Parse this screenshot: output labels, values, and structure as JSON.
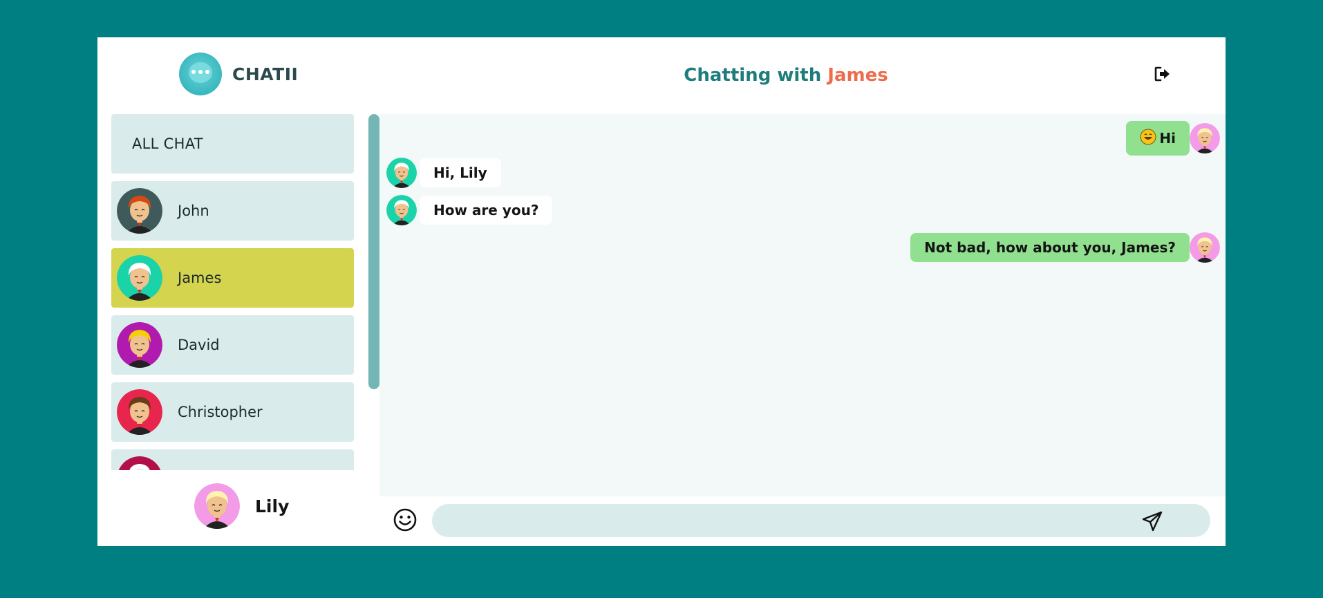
{
  "brand": {
    "name": "CHATII"
  },
  "header": {
    "prefix": "Chatting with",
    "contact": "James",
    "title_color": "#1f7c7c",
    "contact_color": "#ee6b4d",
    "logout_icon": "logout-icon"
  },
  "sidebar": {
    "all_chat": "ALL CHAT",
    "contacts": [
      {
        "name": "John",
        "avatar_bg": "#3f5a5a",
        "hair": "#d44a12",
        "active": false
      },
      {
        "name": "James",
        "avatar_bg": "#1bd3a8",
        "hair": "#ffffff",
        "active": true
      },
      {
        "name": "David",
        "avatar_bg": "#b01aae",
        "hair": "#f4d000",
        "active": false
      },
      {
        "name": "Christopher",
        "avatar_bg": "#e8254c",
        "hair": "#6b3b1a",
        "active": false
      },
      {
        "name": "",
        "avatar_bg": "#b3104a",
        "hair": "#ffffff",
        "active": false
      }
    ]
  },
  "current_user": {
    "name": "Lily",
    "avatar_bg": "#f39be6"
  },
  "messages": [
    {
      "direction": "sent",
      "text": "Hi",
      "emoji": "grinning-face"
    },
    {
      "direction": "received",
      "text": "Hi, Lily"
    },
    {
      "direction": "received",
      "text": "How are you?"
    },
    {
      "direction": "sent",
      "text": "Not bad, how about you, James?"
    }
  ],
  "composer": {
    "value": "",
    "placeholder": "",
    "emoji_icon": "smiley-icon",
    "send_icon": "send-icon"
  },
  "colors": {
    "background": "#007f82",
    "sent_bubble": "#90e090",
    "active_item": "#d4d44e",
    "item_bg": "#d9ebeb"
  }
}
